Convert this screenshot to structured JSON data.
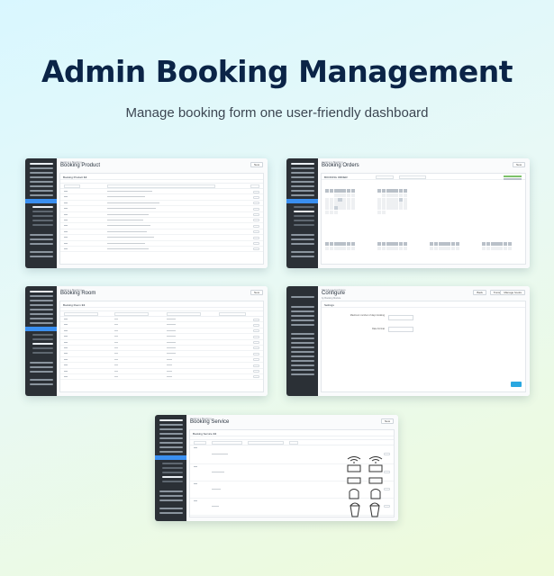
{
  "hero": {
    "title": "Admin Booking Management",
    "subtitle": "Manage booking form one user-friendly dashboard"
  },
  "screens": {
    "product": {
      "title": "Booking Product",
      "panel": "Booking Product",
      "count": "14",
      "button": "New"
    },
    "orders": {
      "title": "Booking Orders",
      "panel": "BOOKING ORDER",
      "button": "New"
    },
    "room": {
      "title": "Booking Room",
      "panel": "Booking Room",
      "count": "14",
      "button": "New"
    },
    "configure": {
      "title": "Configure",
      "subtitle": "by Booking Module",
      "panel": "Settings",
      "field_1": "Maximum number of days booking",
      "field_2": "Date Format",
      "buttons": [
        "Back",
        "Translate",
        "Manage hooks"
      ]
    },
    "service": {
      "title": "Booking Service",
      "panel": "Booking Service",
      "count": "14",
      "button": "New"
    }
  },
  "colors": {
    "sidebar": "#2b3036",
    "active": "#3a8ff0",
    "title": "#0b2447",
    "primary_button": "#2aa7e0"
  },
  "icons": [
    "service-icons"
  ]
}
